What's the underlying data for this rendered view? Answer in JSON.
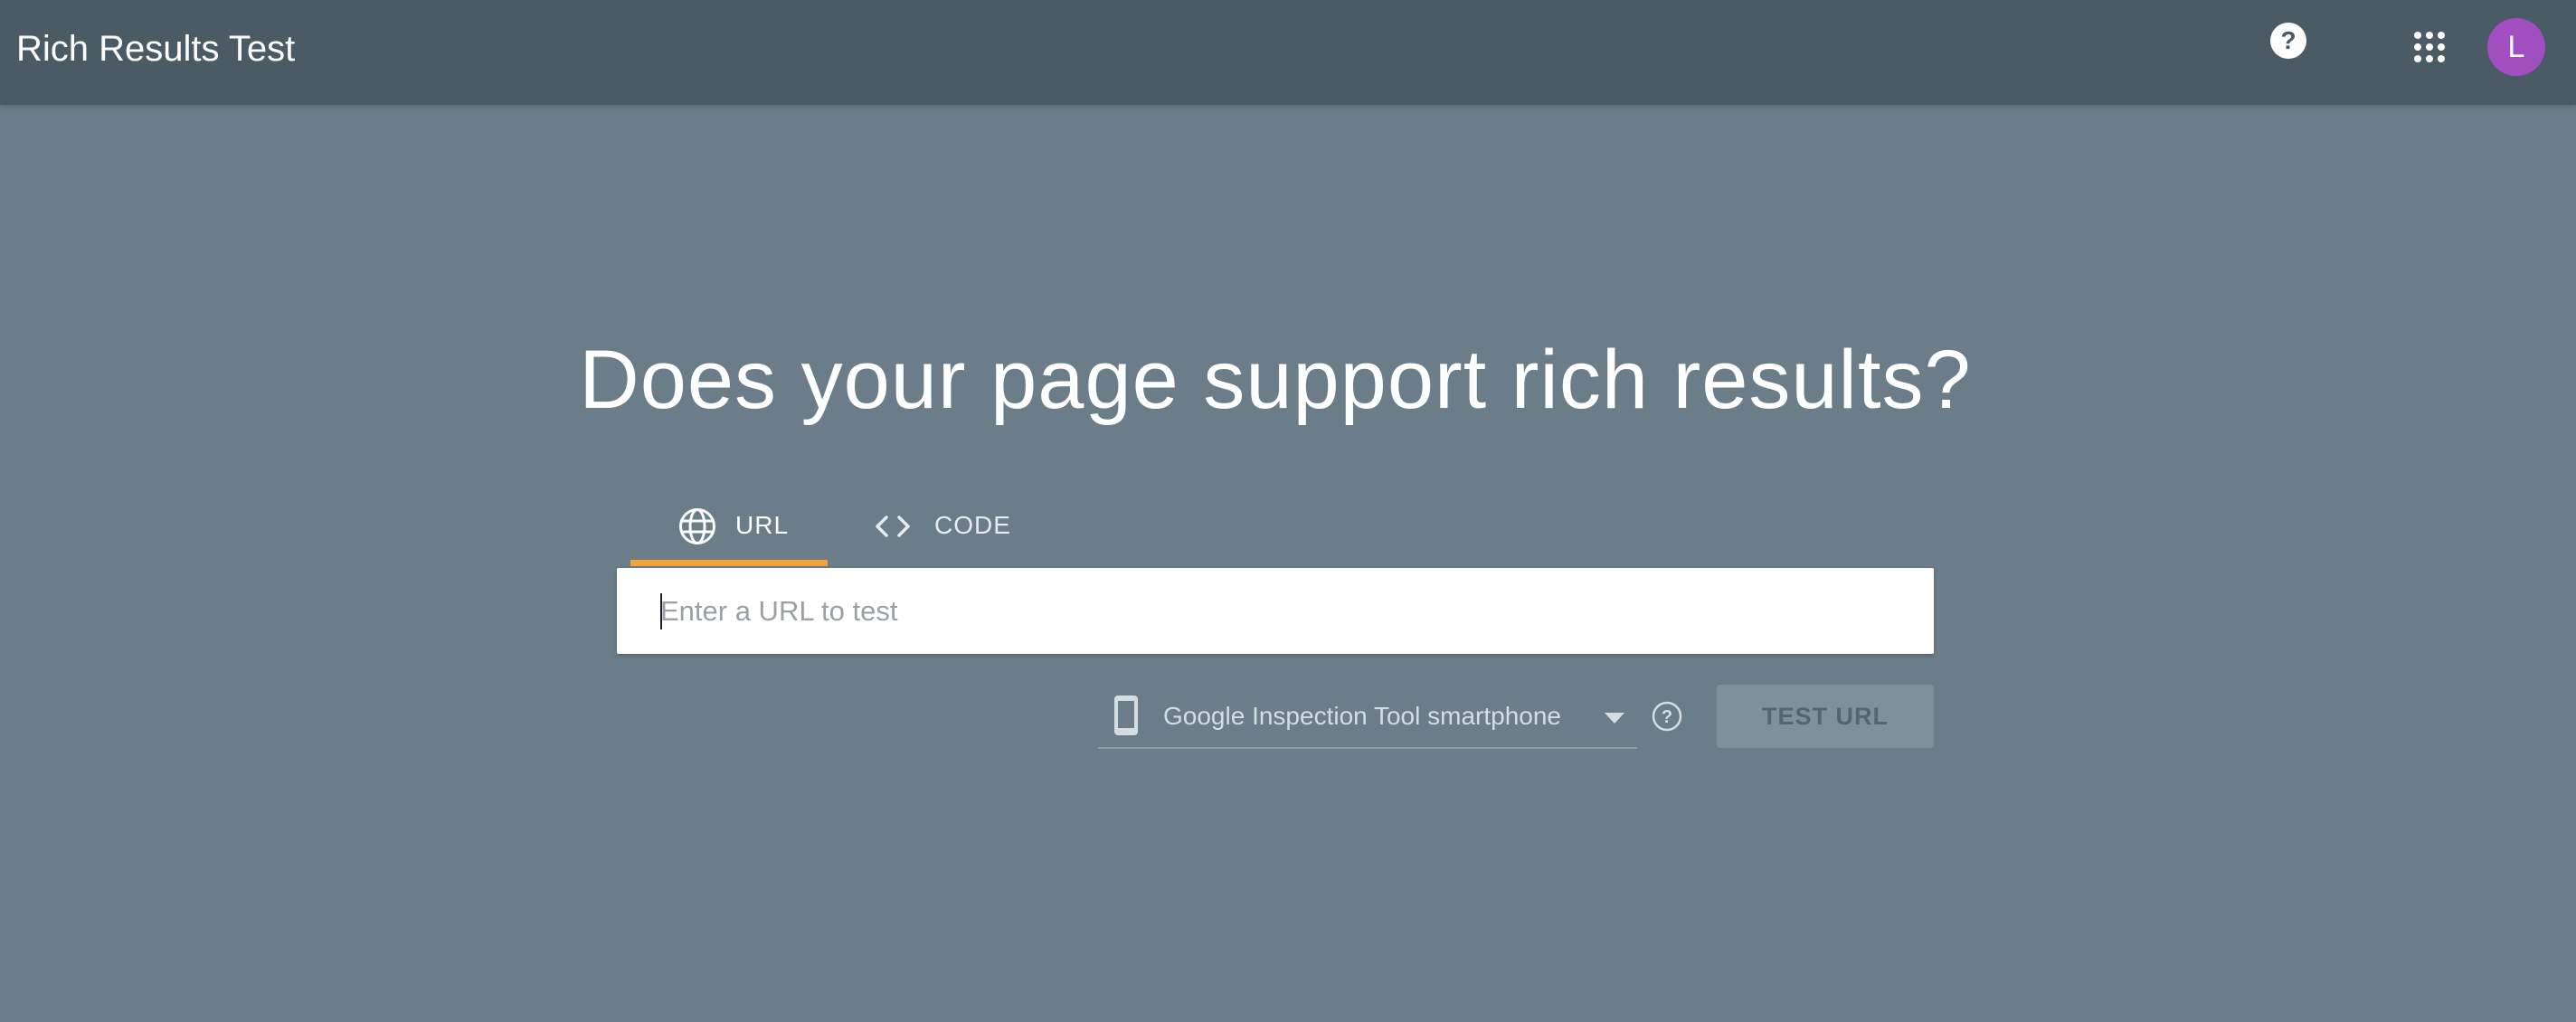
{
  "header": {
    "title": "Rich Results Test",
    "help_icon": "help-circle-icon",
    "apps_icon": "apps-grid-icon",
    "avatar_letter": "L",
    "avatar_color": "#a14fc0",
    "background_color": "#4b5b65"
  },
  "main": {
    "headline": "Does your page support rich results?",
    "tabs": [
      {
        "label": "URL",
        "icon": "globe-icon",
        "selected": true
      },
      {
        "label": "CODE",
        "icon": "code-icon",
        "selected": false
      }
    ],
    "url_input": {
      "placeholder": "Enter a URL to test",
      "value": ""
    },
    "device_select": {
      "icon": "smartphone-icon",
      "selected": "Google Inspection Tool smartphone"
    },
    "info_icon": "help-outline-icon",
    "test_button_label": "TEST URL",
    "test_button_enabled": false,
    "accent_color": "#f2a33a",
    "background_color": "#6a7d88"
  }
}
